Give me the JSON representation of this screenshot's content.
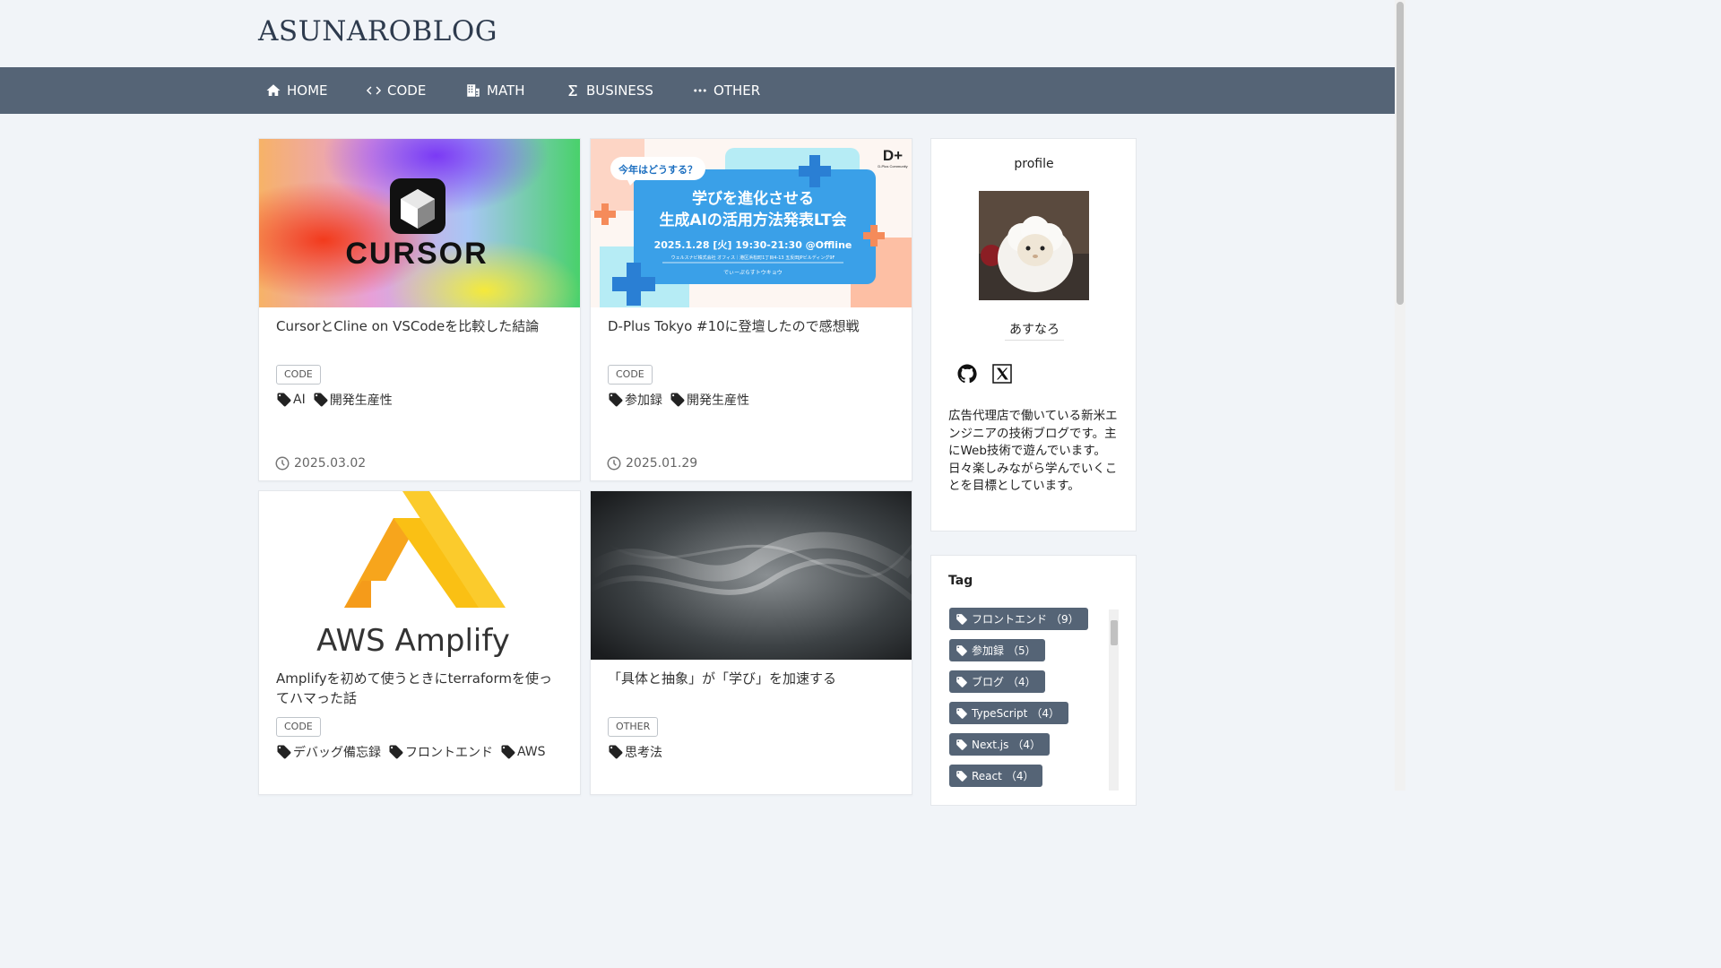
{
  "site": {
    "title": "ASUNAROBLOG"
  },
  "nav": {
    "items": [
      {
        "label": "HOME",
        "icon": "home-icon"
      },
      {
        "label": "CODE",
        "icon": "code-icon"
      },
      {
        "label": "MATH",
        "icon": "building-icon"
      },
      {
        "label": "BUSINESS",
        "icon": "sigma-icon"
      },
      {
        "label": "OTHER",
        "icon": "more-icon"
      }
    ]
  },
  "posts": [
    {
      "title": "CursorとCline on VSCodeを比較した結論",
      "category": "CODE",
      "tags": [
        "AI",
        "開発生産性"
      ],
      "date": "2025.03.02",
      "image": {
        "logo_text": "CURSOR"
      }
    },
    {
      "title": "D-Plus Tokyo #10に登壇したので感想戦",
      "category": "CODE",
      "tags": [
        "参加録",
        "開発生産性"
      ],
      "date": "2025.01.29",
      "image": {
        "badge": "今年はどうする？",
        "headline_1": "学びを進化させる",
        "headline_2": "生成AIの活用方法発表LT会",
        "event_date": "2025.1.28 [火] 19:30-21:30 @Offline",
        "venue": "ウェルスナビ株式会社 オフィス｜港区浜松町1丁目4-13 五反田JPビルディング9F",
        "tagline": "でぃーぷらすトウキョウ",
        "brand": "D+",
        "brand_sub": "D-Plus Community"
      }
    },
    {
      "title": "Amplifyを初めて使うときにterraformを使ってハマった話",
      "category": "CODE",
      "tags": [
        "デバッグ備忘録",
        "フロントエンド",
        "AWS"
      ],
      "image": {
        "logo_text": "AWS Amplify"
      }
    },
    {
      "title": "「具体と抽象」が「学び」を加速する",
      "category": "OTHER",
      "tags": [
        "思考法"
      ]
    }
  ],
  "profile": {
    "heading": "profile",
    "name": "あすなろ",
    "description": "広告代理店で働いている新米エンジニアの技術ブログです。主にWeb技術で遊んでいます。日々楽しみながら学んでいくことを目標としています。",
    "links": [
      "github-icon",
      "x-icon"
    ]
  },
  "tag_panel": {
    "heading": "Tag",
    "tags": [
      {
        "name": "フロントエンド",
        "count": "（9）"
      },
      {
        "name": "参加録",
        "count": "（5）"
      },
      {
        "name": "ブログ",
        "count": "（4）"
      },
      {
        "name": "TypeScript",
        "count": "（4）"
      },
      {
        "name": "Next.js",
        "count": "（4）"
      },
      {
        "name": "React",
        "count": "（4）"
      }
    ]
  },
  "colors": {
    "nav": "#556476",
    "background": "#f1f4f8",
    "title": "#2e3b4e"
  }
}
